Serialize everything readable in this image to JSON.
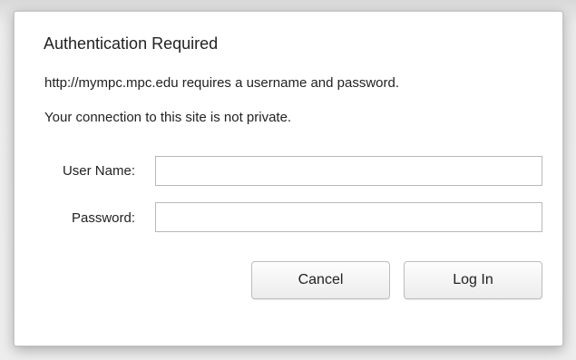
{
  "dialog": {
    "title": "Authentication Required",
    "message": "http://mympc.mpc.edu requires a username and password.",
    "privacy_notice": "Your connection to this site is not private."
  },
  "form": {
    "username": {
      "label": "User Name:",
      "value": "",
      "placeholder": ""
    },
    "password": {
      "label": "Password:",
      "value": "",
      "placeholder": ""
    }
  },
  "buttons": {
    "cancel_label": "Cancel",
    "login_label": "Log In"
  },
  "colors": {
    "dialog_background": "#ffffff",
    "text": "#222222",
    "input_border": "#b9b9b9",
    "button_border": "#bdbdbd"
  }
}
